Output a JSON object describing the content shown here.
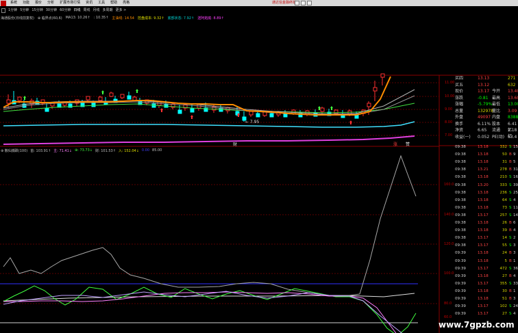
{
  "menu": {
    "items": [
      "系统",
      "功能",
      "报价",
      "分析",
      "扩展市场行情",
      "资讯",
      "工具",
      "帮助",
      "亮格"
    ],
    "brand": "通达信金融终端"
  },
  "periods": [
    "1分钟",
    "5分钟",
    "15分钟",
    "30分钟",
    "60分钟",
    "日线",
    "周线",
    "月线",
    "多周期",
    "更多 >"
  ],
  "main_legend": [
    {
      "text": "海通股份(日线前复权)",
      "color": "#c0c0c0"
    },
    {
      "text": "⊕ 临界点(60,6)",
      "color": "#c0c0c0"
    },
    {
      "text": "MA13: 10.26↑",
      "color": "#c0c0c0"
    },
    {
      "text": ": 10.35↑",
      "color": "#c0c0c0"
    },
    {
      "text": "主油线: 14.54",
      "color": "#ff8c00"
    },
    {
      "text": "控盘成本: 9.32↑",
      "color": "#e0e000"
    },
    {
      "text": "底部状态: 7.92↑",
      "color": "#00d0d0"
    },
    {
      "text": "送阿炮底: 8.89↑",
      "color": "#ff40ff"
    }
  ],
  "sub_legend": [
    {
      "text": "⊕ 散仙捕跌(100)",
      "color": "#c0c0c0"
    },
    {
      "text": "首: 103.91↑",
      "color": "#c0c0c0"
    },
    {
      "text": "主: 71.41↓",
      "color": "#ff80ff"
    },
    {
      "text": "⊕: 73.73↓",
      "color": "#40ff40"
    },
    {
      "text": "财: 101.53↑",
      "color": "#c0c0c0"
    },
    {
      "text": "入: 152.04↓",
      "color": "#e0e000"
    },
    {
      "text": "0.00",
      "color": "#4040ff"
    },
    {
      "text": "85.00",
      "color": "#c0c0c0"
    }
  ],
  "main_axis_labels": [
    "11.00",
    "10.00",
    "9.00",
    "8.00",
    "7.00"
  ],
  "sub_axis_labels": [
    "160.0",
    "140.0",
    "120.0",
    "100.0",
    "80.0",
    "60.0"
  ],
  "chart_annotations": {
    "low_price": "← 7.95",
    "date_tag": "财",
    "right_tags": [
      "涨",
      "赞"
    ]
  },
  "quote": [
    {
      "label": "买四",
      "value": "13.13",
      "extra": "271"
    },
    {
      "label": "买五",
      "value": "13.12",
      "extra": "632"
    },
    {
      "label": "现价",
      "value": "13.17",
      "extra_label": "今开",
      "extra": "13.40"
    },
    {
      "label": "涨跌",
      "value": "-0.81",
      "extra_label": "最高",
      "extra": "13.60"
    },
    {
      "label": "涨幅",
      "value": "-5.79%",
      "extra_label": "最低",
      "extra": "13.00"
    },
    {
      "label": "总量",
      "value": "132978",
      "extra_label": "量比",
      "extra": "3.09"
    },
    {
      "label": "外盘",
      "value": "49097",
      "extra_label": "内盘",
      "extra": "83881"
    },
    {
      "label": "换手",
      "value": "6.11%",
      "extra_label": "股本",
      "extra": "6.41亿"
    },
    {
      "label": "净资",
      "value": "6.65",
      "extra_label": "流通",
      "extra": "2.18亿"
    },
    {
      "label": "收益(一)",
      "value": "0.052",
      "extra_label": "PE(动)",
      "extra": "63.4"
    }
  ],
  "ticks": [
    {
      "time": "09:38",
      "price": "13.18",
      "vol": "332",
      "flag": "S",
      "extra": "15"
    },
    {
      "time": "09:38",
      "price": "13.18",
      "vol": "50",
      "flag": "B",
      "extra": "9"
    },
    {
      "time": "09:38",
      "price": "13.18",
      "vol": "31",
      "flag": "B",
      "extra": "5"
    },
    {
      "time": "09:38",
      "price": "13.21",
      "vol": "278",
      "flag": "B",
      "extra": "31"
    },
    {
      "time": "09:38",
      "price": "13.18",
      "vol": "210",
      "flag": "S",
      "extra": "16"
    },
    {
      "time": "09:38",
      "price": "13.20",
      "vol": "333",
      "flag": "S",
      "extra": "39"
    },
    {
      "time": "09:38",
      "price": "13.18",
      "vol": "236",
      "flag": "S",
      "extra": "25"
    },
    {
      "time": "09:38",
      "price": "13.18",
      "vol": "64",
      "flag": "S",
      "extra": "4"
    },
    {
      "time": "09:38",
      "price": "13.18",
      "vol": "73",
      "flag": "S",
      "extra": "11"
    },
    {
      "time": "09:38",
      "price": "13.17",
      "vol": "257",
      "flag": "S",
      "extra": "14"
    },
    {
      "time": "09:38",
      "price": "13.18",
      "vol": "26",
      "flag": "B",
      "extra": "6"
    },
    {
      "time": "09:38",
      "price": "13.18",
      "vol": "39",
      "flag": "B",
      "extra": "4"
    },
    {
      "time": "09:38",
      "price": "13.17",
      "vol": "14",
      "flag": "S",
      "extra": "2"
    },
    {
      "time": "09:38",
      "price": "13.17",
      "vol": "55",
      "flag": "S",
      "extra": "3"
    },
    {
      "time": "09:39",
      "price": "13.18",
      "vol": "24",
      "flag": "B",
      "extra": "3"
    },
    {
      "time": "09:39",
      "price": "13.18",
      "vol": "5",
      "flag": "B",
      "extra": "1"
    },
    {
      "time": "09:39",
      "price": "13.17",
      "vol": "472",
      "flag": "S",
      "extra": "36"
    },
    {
      "time": "09:39",
      "price": "13.18",
      "vol": "27",
      "flag": "B",
      "extra": "4"
    },
    {
      "time": "09:39",
      "price": "13.17",
      "vol": "355",
      "flag": "S",
      "extra": "33"
    },
    {
      "time": "09:39",
      "price": "13.18",
      "vol": "30",
      "flag": "B",
      "extra": "1"
    },
    {
      "time": "09:39",
      "price": "13.18",
      "vol": "51",
      "flag": "B",
      "extra": "3"
    },
    {
      "time": "09:39",
      "price": "13.17",
      "vol": "102",
      "flag": "S",
      "extra": "24"
    },
    {
      "time": "09:39",
      "price": "13.17",
      "vol": "27",
      "flag": "S",
      "extra": "4"
    }
  ],
  "watermark": "www.7gpzb.com",
  "colors": {
    "up": "#ff3030",
    "down": "#00ffff",
    "red_grid": "#8a0000",
    "orange": "#ff8c00",
    "magenta": "#e040e0",
    "cyan": "#40e0ff"
  }
}
